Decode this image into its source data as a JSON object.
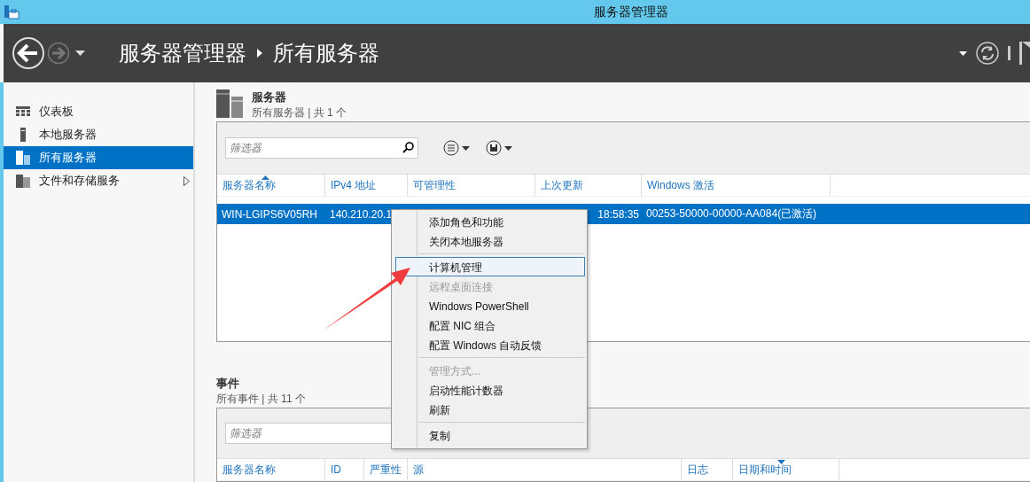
{
  "window": {
    "title": "服务器管理器"
  },
  "header": {
    "breadcrumb": [
      "服务器管理器",
      "所有服务器"
    ],
    "forward_disabled": true
  },
  "sidebar": {
    "items": [
      {
        "label": "仪表板",
        "selected": false,
        "expandable": false
      },
      {
        "label": "本地服务器",
        "selected": false,
        "expandable": false
      },
      {
        "label": "所有服务器",
        "selected": true,
        "expandable": false
      },
      {
        "label": "文件和存储服务",
        "selected": false,
        "expandable": true
      }
    ]
  },
  "servers": {
    "title": "服务器",
    "subtitle": "所有服务器 | 共 1 个",
    "filter": {
      "placeholder": "筛选器"
    },
    "columns": [
      {
        "label": "服务器名称",
        "sorted_up": true,
        "sorted_down": false
      },
      {
        "label": "IPv4 地址",
        "sorted_up": false,
        "sorted_down": false
      },
      {
        "label": "可管理性",
        "sorted_up": false,
        "sorted_down": false
      },
      {
        "label": "上次更新",
        "sorted_up": false,
        "sorted_down": false
      },
      {
        "label": "Windows 激活",
        "sorted_up": false,
        "sorted_down": false
      }
    ],
    "rows": [
      {
        "selected": true,
        "cells": [
          "WIN-LGIPS6V05RH",
          "140.210.20.1",
          "",
          "18:58:35",
          "00253-50000-00000-AA084(已激活)"
        ]
      }
    ]
  },
  "events": {
    "title": "事件",
    "subtitle": "所有事件 | 共 11 个",
    "filter": {
      "placeholder": "筛选器"
    },
    "columns": [
      {
        "label": "服务器名称",
        "sorted_up": false,
        "sorted_down": false
      },
      {
        "label": "ID",
        "sorted_up": false,
        "sorted_down": false
      },
      {
        "label": "严重性",
        "sorted_up": false,
        "sorted_down": false
      },
      {
        "label": "源",
        "sorted_up": false,
        "sorted_down": false
      },
      {
        "label": "日志",
        "sorted_up": false,
        "sorted_down": false
      },
      {
        "label": "日期和时间",
        "sorted_up": false,
        "sorted_down": true
      }
    ]
  },
  "context_menu": {
    "items": [
      {
        "kind": "item",
        "label": "添加角色和功能",
        "disabled": false,
        "selected": false
      },
      {
        "kind": "item",
        "label": "关闭本地服务器",
        "disabled": false,
        "selected": false
      },
      {
        "kind": "separator"
      },
      {
        "kind": "item",
        "label": "计算机管理",
        "disabled": false,
        "selected": true
      },
      {
        "kind": "item",
        "label": "远程桌面连接",
        "disabled": true,
        "selected": false
      },
      {
        "kind": "item",
        "label": "Windows PowerShell",
        "disabled": false,
        "selected": false
      },
      {
        "kind": "item",
        "label": "配置 NIC 组合",
        "disabled": false,
        "selected": false
      },
      {
        "kind": "item",
        "label": "配置 Windows 自动反馈",
        "disabled": false,
        "selected": false
      },
      {
        "kind": "separator"
      },
      {
        "kind": "item",
        "label": "管理方式...",
        "disabled": true,
        "selected": false
      },
      {
        "kind": "item",
        "label": "启动性能计数器",
        "disabled": false,
        "selected": false
      },
      {
        "kind": "item",
        "label": "刷新",
        "disabled": false,
        "selected": false
      },
      {
        "kind": "separator"
      },
      {
        "kind": "item",
        "label": "复制",
        "disabled": false,
        "selected": false
      }
    ]
  }
}
